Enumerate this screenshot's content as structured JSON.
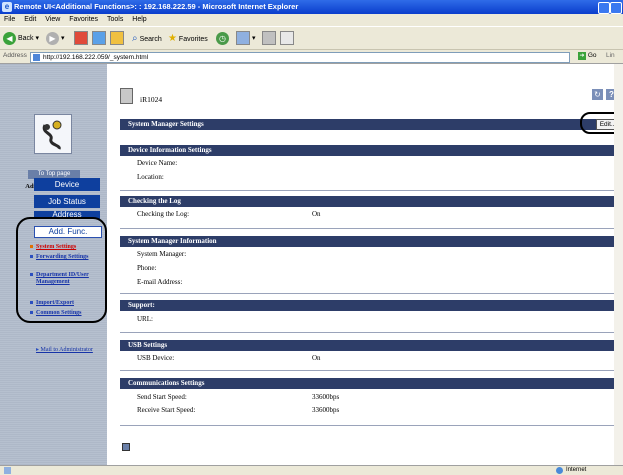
{
  "window": {
    "title": "Remote UI<Additional Functions>: : 192.168.222.59 - Microsoft Internet Explorer"
  },
  "menu": [
    "File",
    "Edit",
    "View",
    "Favorites",
    "Tools",
    "Help"
  ],
  "toolbar": {
    "back": "Back",
    "search": "Search",
    "favorites": "Favorites"
  },
  "address": {
    "label": "Address",
    "url": "http://192.168.222.059/_system.html",
    "go": "Go",
    "links": "Lin"
  },
  "left": {
    "top_page": "To Top page",
    "admin_mode": "Administrator Mode",
    "nav": [
      "Device",
      "Job Status",
      "Address",
      "Add. Func."
    ],
    "subnav": [
      "System Settings",
      "Forwarding Settings",
      "Department ID/User Management",
      "Import/Export",
      "Common Settings"
    ],
    "mail": "Mail to Administrator"
  },
  "main": {
    "device_name": "iR1024",
    "page_header": "System Manager Settings",
    "edit": "Edit...",
    "sections": [
      {
        "title": "Device Information Settings",
        "rows": [
          {
            "label": "Device Name:",
            "value": ""
          },
          {
            "label": "Location:",
            "value": ""
          }
        ]
      },
      {
        "title": "Checking the Log",
        "rows": [
          {
            "label": "Checking the Log:",
            "value": "On"
          }
        ]
      },
      {
        "title": "System Manager Information",
        "rows": [
          {
            "label": "System Manager:",
            "value": ""
          },
          {
            "label": "Phone:",
            "value": ""
          },
          {
            "label": "E-mail Address:",
            "value": ""
          }
        ]
      },
      {
        "title": "Support:",
        "rows": [
          {
            "label": "URL:",
            "value": ""
          }
        ]
      },
      {
        "title": "USB Settings",
        "rows": [
          {
            "label": "USB Device:",
            "value": "On"
          }
        ]
      },
      {
        "title": "Communications Settings",
        "rows": [
          {
            "label": "Send Start Speed:",
            "value": "33600bps"
          },
          {
            "label": "Receive Start Speed:",
            "value": "33600bps"
          }
        ]
      }
    ]
  },
  "status": {
    "zone": "Internet"
  },
  "colors": {
    "header_bg": "#2d3d68",
    "nav_bg": "#0e3f9e",
    "active_link": "#cc0000"
  }
}
